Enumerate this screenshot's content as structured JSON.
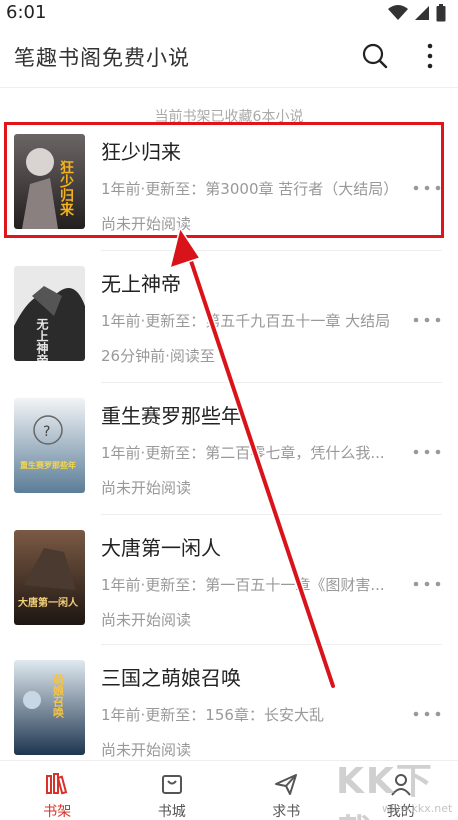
{
  "status_bar": {
    "time": "6:01"
  },
  "app_bar": {
    "title": "笔趣书阁免费小说"
  },
  "shelf": {
    "summary": "当前书架已收藏6本小说",
    "books": [
      {
        "title": "狂少归来",
        "meta": "1年前·更新至：第3000章 苦行者（大结局）",
        "progress": "尚未开始阅读"
      },
      {
        "title": "无上神帝",
        "meta": "1年前·更新至：第五千九百五十一章 大结局",
        "progress": "26分钟前·阅读至"
      },
      {
        "title": "重生赛罗那些年",
        "meta": "1年前·更新至：第二百零七章，凭什么我...",
        "progress": "尚未开始阅读"
      },
      {
        "title": "大唐第一闲人",
        "meta": "1年前·更新至：第一百五十一章《图财害...",
        "progress": "尚未开始阅读"
      },
      {
        "title": "三国之萌娘召唤",
        "meta": "1年前·更新至：156章：长安大乱",
        "progress": "尚未开始阅读"
      }
    ]
  },
  "covers": [
    {
      "text": "狂少归来",
      "bg": "#3a3636",
      "fg": "#f3b21e"
    },
    {
      "text": "无上神帝",
      "bg": "#2b2b2b",
      "fg": "#e8e8e8"
    },
    {
      "text": "重生赛罗那些年",
      "bg": "#6c8ea8",
      "fg": "#f6d74a"
    },
    {
      "text": "大唐第一闲人",
      "bg": "#3a2a22",
      "fg": "#f2d07a"
    },
    {
      "text": "萌娘召唤",
      "bg": "#2f4a6e",
      "fg": "#f3c448"
    }
  ],
  "bottom_nav": [
    {
      "label": "书架",
      "icon": "bookshelf-icon",
      "active": true
    },
    {
      "label": "书城",
      "icon": "store-icon",
      "active": false
    },
    {
      "label": "求书",
      "icon": "paper-plane-icon",
      "active": false
    },
    {
      "label": "我的",
      "icon": "profile-icon",
      "active": false
    }
  ],
  "watermark": {
    "text": "KK下载",
    "sub": "www.kkx.net"
  },
  "colors": {
    "accent": "#d9322a",
    "annotation": "#e0151a"
  }
}
